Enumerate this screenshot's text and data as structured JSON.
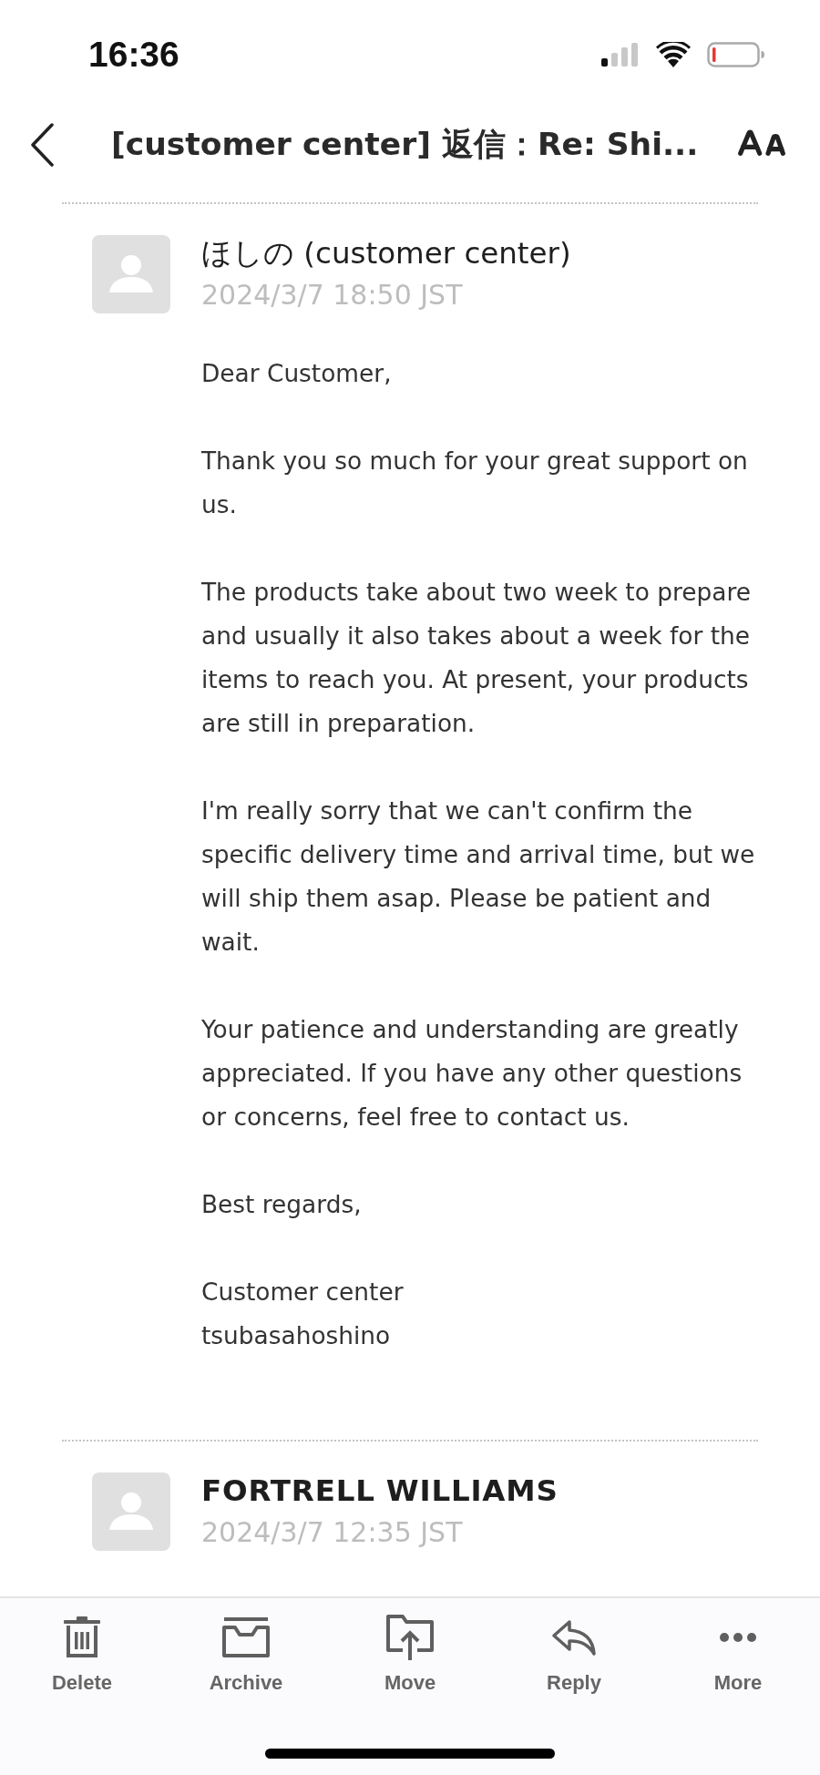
{
  "status_bar": {
    "time": "16:36"
  },
  "header": {
    "title": "[customer center] 返信：Re: Shi..."
  },
  "messages": [
    {
      "sender": "ほしの (customer center)",
      "unread": false,
      "date": "2024/3/7 18:50 JST",
      "body": [
        "Dear Customer,",
        "Thank you so much for your great support on us.",
        "The products take about two week to prepare and usually it also takes about a week for the items to reach you. At present, your products are still in preparation.",
        "I'm really sorry that we can't confirm the specific delivery time and arrival time, but we will ship them asap. Please be patient and wait.",
        "Your patience and understanding are greatly appreciated. If you have any other questions or concerns, feel free to contact us.",
        "Best regards,",
        "Customer center\ntsubasahoshino"
      ]
    },
    {
      "sender": "FORTRELL WILLIAMS",
      "unread": true,
      "date": "2024/3/7 12:35 JST"
    }
  ],
  "toolbar": [
    {
      "kind": "delete",
      "label": "Delete"
    },
    {
      "kind": "archive",
      "label": "Archive"
    },
    {
      "kind": "move",
      "label": "Move"
    },
    {
      "kind": "reply",
      "label": "Reply"
    },
    {
      "kind": "more",
      "label": "More"
    }
  ]
}
